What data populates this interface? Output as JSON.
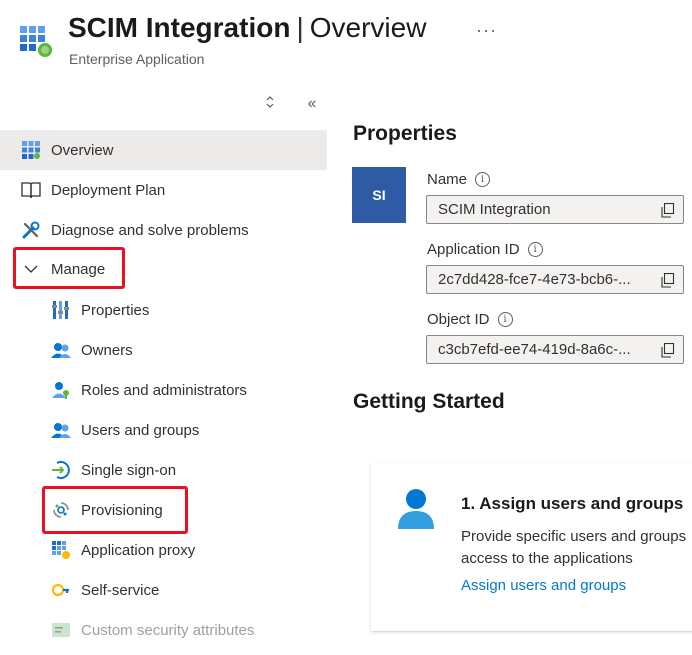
{
  "header": {
    "app_name": "SCIM Integration",
    "separator": "|",
    "page_name": "Overview",
    "more": "···",
    "subtitle": "Enterprise Application"
  },
  "sidebar": {
    "updown_glyph": "⇳",
    "collapse_glyph": "«",
    "items": [
      {
        "label": "Overview",
        "icon": "grid-icon",
        "selected": true
      },
      {
        "label": "Deployment Plan",
        "icon": "book-icon"
      },
      {
        "label": "Diagnose and solve problems",
        "icon": "wrench-icon"
      },
      {
        "label": "Manage",
        "icon": "chevron-down-icon",
        "expanded": true
      },
      {
        "label": "Properties",
        "icon": "properties-icon"
      },
      {
        "label": "Owners",
        "icon": "owners-icon"
      },
      {
        "label": "Roles and administrators",
        "icon": "roles-icon"
      },
      {
        "label": "Users and groups",
        "icon": "users-icon"
      },
      {
        "label": "Single sign-on",
        "icon": "sso-icon"
      },
      {
        "label": "Provisioning",
        "icon": "provisioning-icon"
      },
      {
        "label": "Application proxy",
        "icon": "app-proxy-icon"
      },
      {
        "label": "Self-service",
        "icon": "self-service-icon"
      },
      {
        "label": "Custom security attributes",
        "icon": "custom-attributes-icon",
        "disabled": true
      }
    ]
  },
  "properties": {
    "heading": "Properties",
    "avatar_initials": "SI",
    "name_label": "Name",
    "name_value": "SCIM Integration",
    "app_id_label": "Application ID",
    "app_id_value": "2c7dd428-fce7-4e73-bcb6-...",
    "object_id_label": "Object ID",
    "object_id_value": "c3cb7efd-ee74-419d-8a6c-...",
    "info_glyph": "i"
  },
  "getting_started": {
    "heading": "Getting Started",
    "card": {
      "title": "1. Assign users and groups",
      "description": "Provide specific users and groups access to the applications",
      "link": "Assign users and groups"
    }
  },
  "colors": {
    "accent": "#0078d4",
    "avatar_bg": "#2e5ba4",
    "highlight_box": "#e81123",
    "selected_bg": "#edebe9"
  }
}
